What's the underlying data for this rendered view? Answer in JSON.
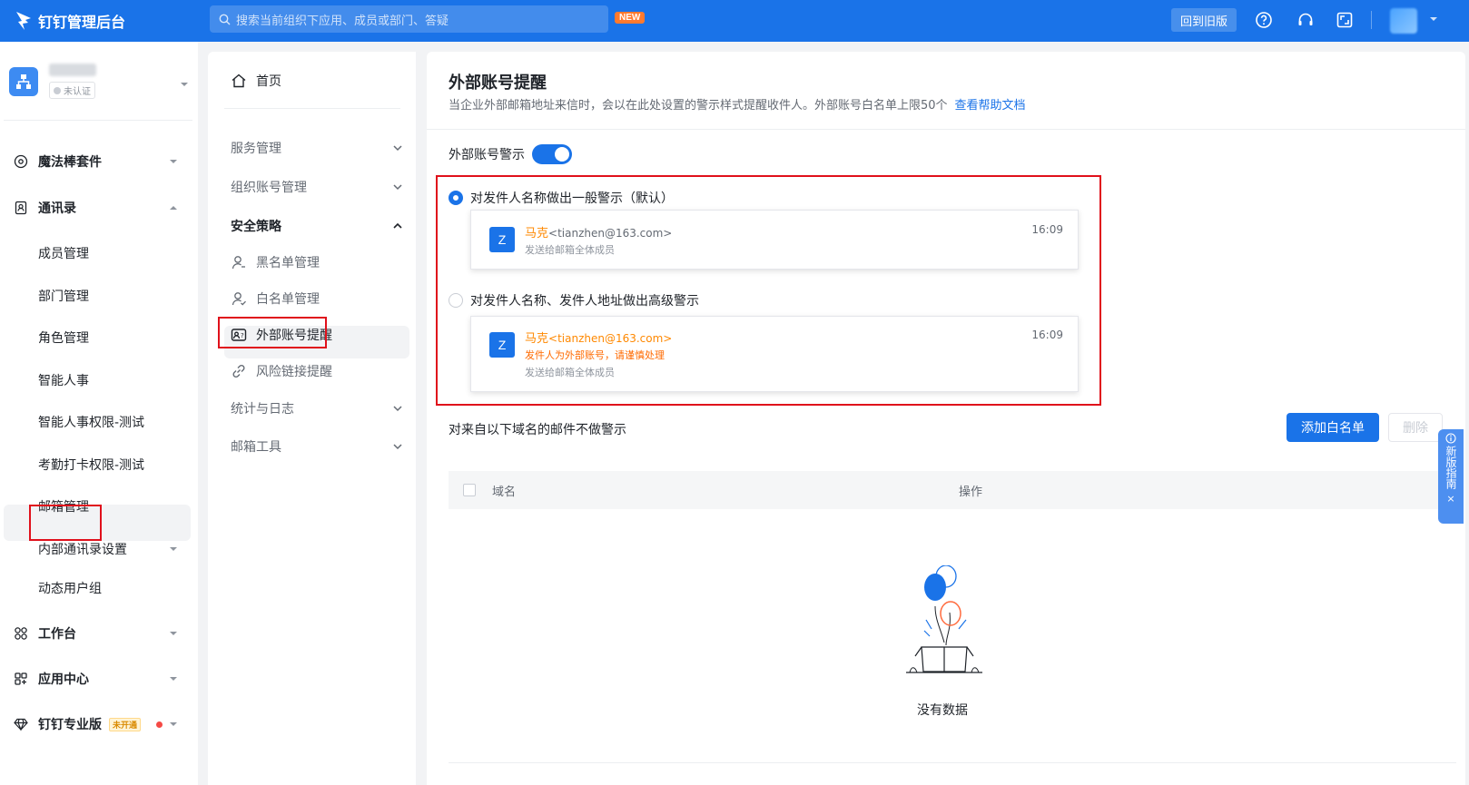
{
  "topbar": {
    "app_title": "钉钉管理后台",
    "search_placeholder": "搜索当前组织下应用、成员或部门、答疑",
    "new_badge": "NEW",
    "old_version_label": "回到旧版",
    "icons": [
      "help-icon",
      "headset-icon",
      "fullscreen-icon",
      "chevron-down-icon"
    ]
  },
  "org": {
    "status": "未认证"
  },
  "sidebar": {
    "items": [
      {
        "label": "魔法棒套件",
        "group": true
      },
      {
        "label": "通讯录",
        "group": true
      },
      {
        "label": "成员管理"
      },
      {
        "label": "部门管理"
      },
      {
        "label": "角色管理"
      },
      {
        "label": "智能人事"
      },
      {
        "label": "智能人事权限-测试"
      },
      {
        "label": "考勤打卡权限-测试"
      },
      {
        "label": "邮箱管理",
        "selected": true
      },
      {
        "label": "内部通讯录设置"
      },
      {
        "label": "动态用户组"
      },
      {
        "label": "工作台",
        "group": true
      },
      {
        "label": "应用中心",
        "group": true
      },
      {
        "label": "钉钉专业版",
        "group": true
      }
    ],
    "pro_badge": "未开通"
  },
  "nav2": {
    "home": "首页",
    "items": [
      "服务管理",
      "组织账号管理",
      "安全策略",
      "黑名单管理",
      "白名单管理",
      "外部账号提醒",
      "风险链接提醒",
      "统计与日志",
      "邮箱工具"
    ]
  },
  "main": {
    "title": "外部账号提醒",
    "description": "当企业外部邮箱地址来信时，会以在此处设置的警示样式提醒收件人。外部账号白名单上限50个",
    "help_link": "查看帮助文档",
    "toggle_label": "外部账号警示",
    "toggle_on": true,
    "option1": "对发件人名称做出一般警示（默认）",
    "option2": "对发件人名称、发件人地址做出高级警示",
    "card": {
      "avatar": "Z",
      "name": "马克",
      "email": "<tianzhen@163.com>",
      "time": "16:09",
      "recipients": "发送给邮箱全体成员",
      "warning": "发件人为外部账号，请谨慎处理"
    },
    "whitelist_title": "对来自以下域名的邮件不做警示",
    "add_button": "添加白名单",
    "delete_button": "删除",
    "col_domain": "域名",
    "col_action": "操作",
    "empty_text": "没有数据"
  },
  "guide": {
    "label": "新版指南",
    "close": "×"
  },
  "colors": {
    "brand": "#1a73e8",
    "highlight": "#e0101b",
    "warning": "#ff8800"
  }
}
